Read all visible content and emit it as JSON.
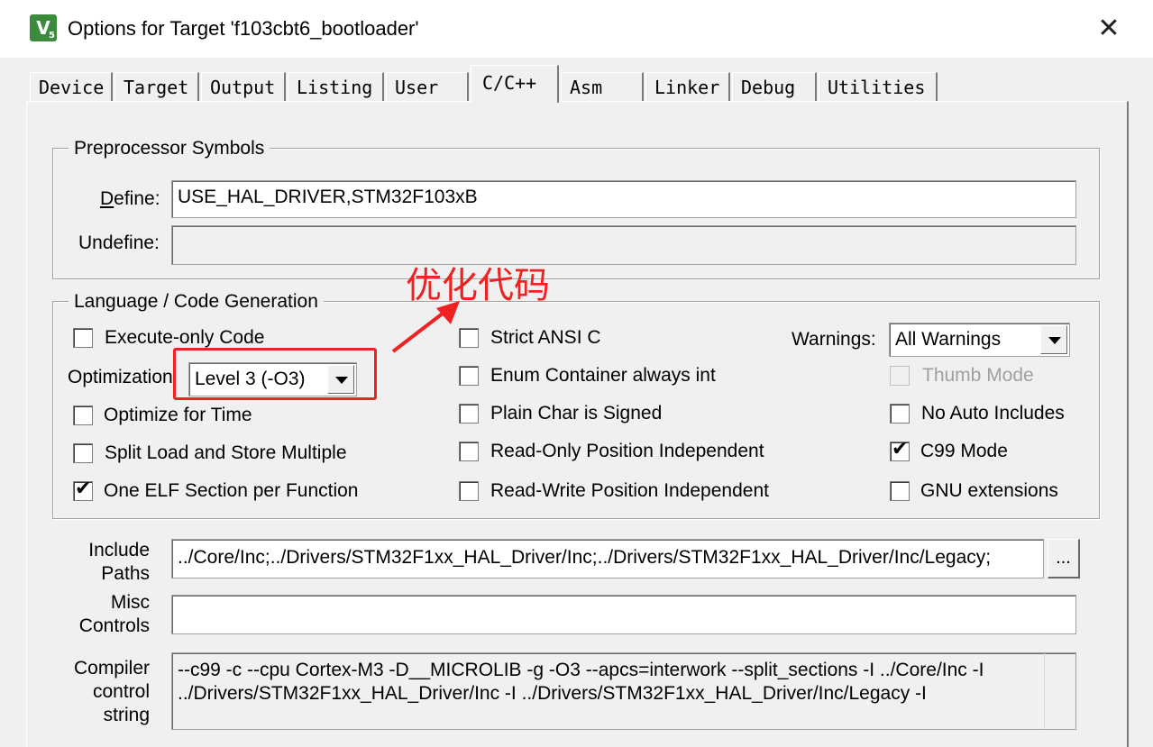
{
  "window": {
    "title": "Options for Target 'f103cbt6_bootloader'",
    "app_icon_letter": "V",
    "app_icon_sub": "5",
    "close_glyph": "✕"
  },
  "tabs": [
    "Device",
    "Target",
    "Output",
    "Listing",
    "User",
    "C/C++",
    "Asm",
    "Linker",
    "Debug",
    "Utilities"
  ],
  "active_tab": "C/C++",
  "preprocessor": {
    "group_title": "Preprocessor Symbols",
    "define_label": "Define:",
    "define_value": "USE_HAL_DRIVER,STM32F103xB",
    "undefine_label": "Undefine:",
    "undefine_value": ""
  },
  "language": {
    "group_title": "Language / Code Generation",
    "execute_only": {
      "label": "Execute-only Code",
      "checked": false
    },
    "optimization_label": "Optimization",
    "optimization_value": "Level 3 (-O3)",
    "optimize_time": {
      "label": "Optimize for Time",
      "checked": false
    },
    "split_load": {
      "label": "Split Load and Store Multiple",
      "checked": false
    },
    "one_elf": {
      "label": "One ELF Section per Function",
      "checked": true
    },
    "strict_ansi": {
      "label": "Strict ANSI C",
      "checked": false
    },
    "enum_container": {
      "label": "Enum Container always int",
      "checked": false
    },
    "plain_char": {
      "label": "Plain Char is Signed",
      "checked": false
    },
    "ro_pi": {
      "label": "Read-Only Position Independent",
      "checked": false
    },
    "rw_pi": {
      "label": "Read-Write Position Independent",
      "checked": false
    },
    "warnings_label": "Warnings:",
    "warnings_value": "All Warnings",
    "thumb_mode": {
      "label": "Thumb Mode",
      "checked": false,
      "disabled": true
    },
    "no_auto_includes": {
      "label": "No Auto Includes",
      "checked": false
    },
    "c99_mode": {
      "label": "C99 Mode",
      "checked": true
    },
    "gnu_extensions": {
      "label": "GNU extensions",
      "checked": false
    }
  },
  "include": {
    "label_line1": "Include",
    "label_line2": "Paths",
    "value": "../Core/Inc;../Drivers/STM32F1xx_HAL_Driver/Inc;../Drivers/STM32F1xx_HAL_Driver/Inc/Legacy;",
    "browse_label": "..."
  },
  "misc": {
    "label_line1": "Misc",
    "label_line2": "Controls",
    "value": ""
  },
  "compiler": {
    "label_line1": "Compiler",
    "label_line2": "control",
    "label_line3": "string",
    "line1": "--c99 -c --cpu Cortex-M3 -D__MICROLIB -g -O3 --apcs=interwork --split_sections -I ../Core/Inc -I",
    "line2": "../Drivers/STM32F1xx_HAL_Driver/Inc -I ../Drivers/STM32F1xx_HAL_Driver/Inc/Legacy -I"
  },
  "annotation": {
    "text": "优化代码",
    "color": "#ee2222"
  }
}
